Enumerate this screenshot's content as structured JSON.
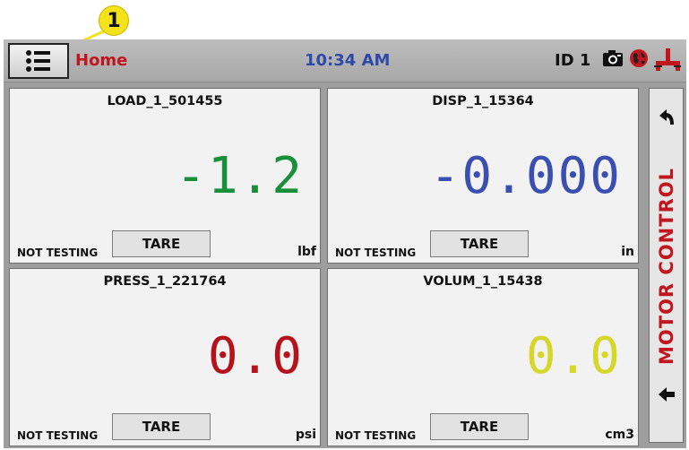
{
  "callout": {
    "number": "1",
    "color": "#f4e21a"
  },
  "header": {
    "title": "Home",
    "time": "10:34 AM",
    "id_label": "ID 1",
    "title_color": "#c0171f",
    "time_color": "#2d4aa8",
    "icons": [
      "menu-list-icon",
      "camera-icon",
      "globe-icon",
      "network-icon"
    ]
  },
  "panels": [
    {
      "title": "LOAD_1_501455",
      "value": "-1.2",
      "unit": "lbf",
      "status": "NOT TESTING",
      "tare_label": "TARE",
      "value_color": "#1a8f3a"
    },
    {
      "title": "DISP_1_15364",
      "value": "-0.000",
      "unit": "in",
      "status": "NOT TESTING",
      "tare_label": "TARE",
      "value_color": "#3b4fb0"
    },
    {
      "title": "PRESS_1_221764",
      "value": "0.0",
      "unit": "psi",
      "status": "NOT TESTING",
      "tare_label": "TARE",
      "value_color": "#b5121b"
    },
    {
      "title": "VOLUM_1_15438",
      "value": "0.0",
      "unit": "cm3",
      "status": "NOT TESTING",
      "tare_label": "TARE",
      "value_color": "#d7d72a"
    }
  ],
  "motor_control": {
    "label": "MOTOR CONTROL",
    "color": "#c0171f",
    "icons": [
      "arrow-up-left-icon",
      "arrow-left-icon"
    ]
  }
}
